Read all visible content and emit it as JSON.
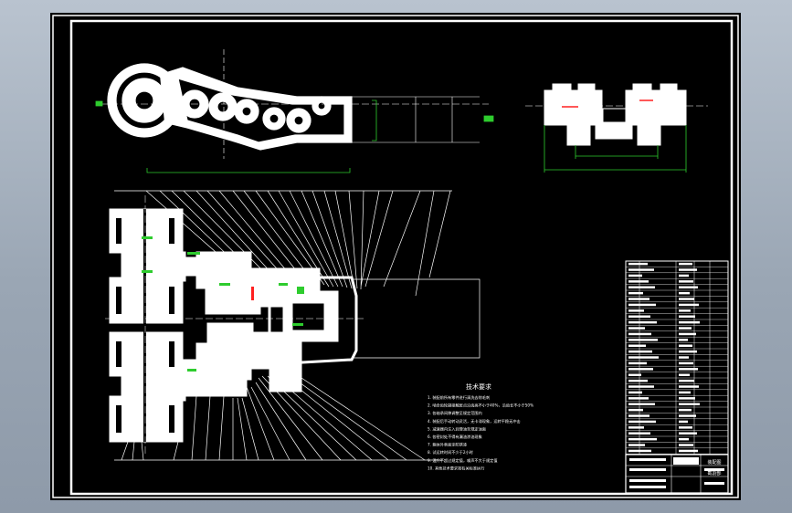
{
  "drawing": {
    "background_color": "#000000",
    "line_color": "#ffffff",
    "dimension_color": "#00cc00",
    "accent_color": "#ff2020",
    "tech_requirements": {
      "title": "技术要求",
      "items": [
        "1. 装配前所有零件进行清洗去除毛刺",
        "2. 啮合齿轮副接触斑点沿齿高不小于40%，沿齿长不小于50%",
        "3. 各轴承间隙调整至规定范围内",
        "4. 装配后手动转动灵活，无卡滞现象，运转平稳无冲击",
        "5. 减速器内注入润滑油至规定油面",
        "6. 各密封处不得有漏油渗油现象",
        "7. 箱体外表面涂防锈漆",
        "8. 试运转时间不少于2小时",
        "9. 温升不超过规定值，噪声不大于规定值",
        "10. 其他技术要求按有关标准执行"
      ]
    },
    "title_block": {
      "name": "装配图",
      "drawing_no": "截割部"
    }
  }
}
